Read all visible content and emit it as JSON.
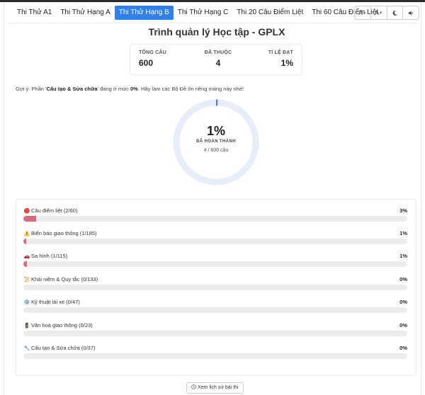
{
  "tabs": [
    {
      "label": "Thi Thử A1",
      "active": false
    },
    {
      "label": "Thi Thử Hạng A",
      "active": false
    },
    {
      "label": "Thi Thử Hạng B",
      "active": true
    },
    {
      "label": "Thi Thử Hạng C",
      "active": false
    },
    {
      "label": "Thi 20 Câu Điểm Liệt",
      "active": false
    },
    {
      "label": "Thi 60 Câu Điểm Liệt",
      "active": false
    }
  ],
  "tools": {
    "font_decrease": "A−",
    "font_increase": "A+",
    "dark_mode_icon": "moon-icon",
    "sound_icon": "speaker-icon"
  },
  "title": "Trình quản lý Học tập - GPLX",
  "stats": [
    {
      "label": "TỔNG CÂU",
      "value": "600"
    },
    {
      "label": "ĐÃ THUỘC",
      "value": "4"
    },
    {
      "label": "TỈ LỆ ĐẠT",
      "value": "1%"
    }
  ],
  "hint": {
    "prefix": "Gợi ý: Phần '",
    "category": "Cấu tạo & Sửa chữa",
    "middle": "' đang ở mức ",
    "level": "0%",
    "suffix": ". Hãy làm các Bộ Đề ôn riêng mảng này nhé!"
  },
  "progress": {
    "percent_text": "1%",
    "percent": 0.67,
    "label": "ĐÃ HOÀN THÀNH",
    "sub": "4 / 600 câu",
    "ring_color": "#4f86d8",
    "track_color": "#e8eef9"
  },
  "categories": [
    {
      "icon": "🔴",
      "label": "Câu điểm liệt (2/60)",
      "percent_text": "3%",
      "fraction": 0.0333
    },
    {
      "icon": "⚠️",
      "label": "Biển báo giao thông (1/185)",
      "percent_text": "1%",
      "fraction": 0.0054
    },
    {
      "icon": "🚗",
      "label": "Sa hình (1/115)",
      "percent_text": "1%",
      "fraction": 0.0087
    },
    {
      "icon": "📜",
      "label": "Khái niệm & Quy tắc (0/133)",
      "percent_text": "0%",
      "fraction": 0
    },
    {
      "icon": "⚙️",
      "label": "Kỹ thuật lái xe (0/47)",
      "percent_text": "0%",
      "fraction": 0
    },
    {
      "icon": "🚦",
      "label": "Văn hoá giao thông (0/23)",
      "percent_text": "0%",
      "fraction": 0
    },
    {
      "icon": "🔧",
      "label": "Cấu tạo & Sửa chữa (0/37)",
      "percent_text": "0%",
      "fraction": 0
    }
  ],
  "history_button": {
    "icon": "clock-icon",
    "label": "Xem lịch sử bài thi"
  },
  "colors": {
    "accent": "#2f80ed",
    "bar_fill": "#df6a76",
    "bar_track": "#ececec"
  }
}
